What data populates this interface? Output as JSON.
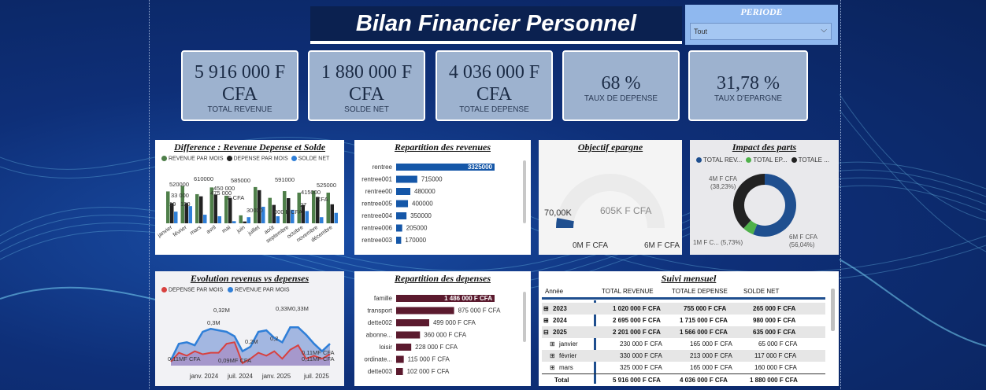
{
  "title": "Bilan Financier Personnel",
  "period": {
    "label": "PERIODE",
    "selected": "Tout"
  },
  "kpis": [
    {
      "value": "5 916 000 F CFA",
      "caption": "TOTAL REVENUE"
    },
    {
      "value": "1 880 000 F CFA",
      "caption": "SOLDE NET"
    },
    {
      "value": "4 036 000 F CFA",
      "caption": "TOTALE DEPENSE"
    },
    {
      "value": "68 %",
      "caption": "TAUX DE DEPENSE"
    },
    {
      "value": "31,78 %",
      "caption": "TAUX D'EPARGNE"
    }
  ],
  "colors": {
    "revenue": "#4f7f4a",
    "depense": "#222222",
    "solde": "#2f7fd8",
    "bar_blue": "#1557a8",
    "bar_maroon": "#5b1a2e",
    "donut_blue": "#1f4f8f",
    "donut_green": "#4fb14a"
  },
  "diff_chart": {
    "title": "Difference : Revenue Depense et Solde",
    "legend": [
      "REVENUE PAR MOIS",
      "DEPENSE PAR MOIS",
      "SOLDE NET"
    ],
    "data_labels": [
      "520000",
      "610000",
      "585000",
      "591000",
      "525000",
      "33 000",
      "475 000",
      "450 000",
      "415000",
      "130",
      "F CFA",
      "30000",
      "000 F CFA",
      "19",
      "27",
      "CFA"
    ],
    "months": [
      "janvier",
      "février",
      "mars",
      "avril",
      "mai",
      "juin",
      "juillet",
      "août",
      "septembre",
      "octobre",
      "novembre",
      "décembre"
    ]
  },
  "rev_chart": {
    "title": "Repartition des revenues",
    "items": [
      {
        "name": "rentree",
        "value": 3325000,
        "label": "3325000"
      },
      {
        "name": "rentree001",
        "value": 715000,
        "label": "715000"
      },
      {
        "name": "rentree00",
        "value": 480000,
        "label": "480000"
      },
      {
        "name": "rentree005",
        "value": 400000,
        "label": "400000"
      },
      {
        "name": "rentree004",
        "value": 350000,
        "label": "350000"
      },
      {
        "name": "rentree006",
        "value": 205000,
        "label": "205000"
      },
      {
        "name": "rentree003",
        "value": 170000,
        "label": "170000"
      }
    ]
  },
  "gauge": {
    "title": "Objectif epargne",
    "value_label": "70,00K",
    "target_label": "605K F CFA",
    "min_label": "0M F CFA",
    "max_label": "6M F CFA",
    "value": 70000,
    "min": 0,
    "max": 6000000
  },
  "donut": {
    "title": "Impact des parts",
    "legend": [
      "TOTAL REV...",
      "TOTAL EP...",
      "TOTALE ..."
    ],
    "labels": [
      {
        "t1": "4M F CFA",
        "t2": "(38,23%)"
      },
      {
        "t1": "1M F C... (5,73%)",
        "t2": ""
      },
      {
        "t1": "6M F CFA",
        "t2": "(56,04%)"
      }
    ],
    "slices": [
      {
        "name": "TOTAL REV...",
        "pct": 56.04
      },
      {
        "name": "TOTAL EP...",
        "pct": 5.73
      },
      {
        "name": "TOTALE ...",
        "pct": 38.23
      }
    ]
  },
  "evo_chart": {
    "title": "Evolution revenus vs depenses",
    "legend": [
      "DEPENSE PAR MOIS",
      "REVENUE PAR MOIS"
    ],
    "x_ticks": [
      "janv. 2024",
      "juil. 2024",
      "janv. 2025",
      "juil. 2025"
    ],
    "annotations": [
      "0,32M",
      "0,33M",
      "0,33M",
      "0,3M",
      "0,2",
      "0,2M",
      "0,11MF CFA",
      "0,09MF CFA",
      "0,11MF CFA",
      "0,11MF CFA"
    ]
  },
  "dep_chart": {
    "title": "Repartition des depenses",
    "items": [
      {
        "name": "famille",
        "value": 1486000,
        "label": "1 486 000 F CFA"
      },
      {
        "name": "transport",
        "value": 875000,
        "label": "875 000 F CFA"
      },
      {
        "name": "dette002",
        "value": 499000,
        "label": "499 000 F CFA"
      },
      {
        "name": "abonne...",
        "value": 360000,
        "label": "360 000 F CFA"
      },
      {
        "name": "loisir",
        "value": 228000,
        "label": "228 000 F CFA"
      },
      {
        "name": "ordinate...",
        "value": 115000,
        "label": "115 000 F CFA"
      },
      {
        "name": "dette003",
        "value": 102000,
        "label": "102 000 F CFA"
      }
    ]
  },
  "table": {
    "title": "Suivi mensuel",
    "headers": [
      "Année",
      "TOTAL REVENUE",
      "TOTALE DEPENSE",
      "SOLDE NET"
    ],
    "rows": [
      {
        "c": [
          "2023",
          "1 020 000 F CFA",
          "755 000 F CFA",
          "265 000 F CFA"
        ]
      },
      {
        "c": [
          "2024",
          "2 695 000 F CFA",
          "1 715 000 F CFA",
          "980 000 F CFA"
        ]
      },
      {
        "c": [
          "2025",
          "2 201 000 F CFA",
          "1 566 000 F CFA",
          "635 000 F CFA"
        ]
      },
      {
        "c": [
          "janvier",
          "230 000 F CFA",
          "165 000 F CFA",
          "65 000 F CFA"
        ]
      },
      {
        "c": [
          "février",
          "330 000 F CFA",
          "213 000 F CFA",
          "117 000 F CFA"
        ]
      },
      {
        "c": [
          "mars",
          "325 000 F CFA",
          "165 000 F CFA",
          "160 000 F CFA"
        ]
      }
    ],
    "total": [
      "Total",
      "5 916 000 F CFA",
      "4 036 000 F CFA",
      "1 880 000 F CFA"
    ],
    "expanders": [
      "⊞",
      "⊞",
      "⊟",
      "⊞",
      "⊞",
      "⊞"
    ]
  }
}
